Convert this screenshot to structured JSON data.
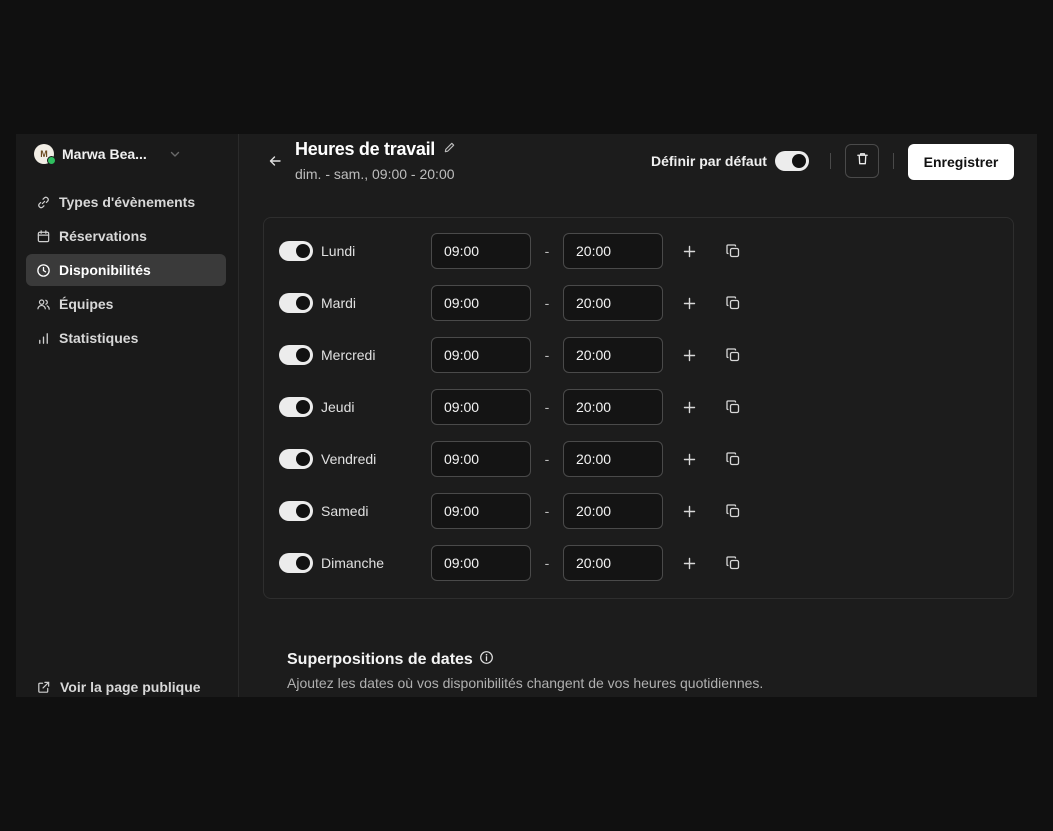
{
  "user": {
    "name": "Marwa Bea...",
    "avatar_initial": "M"
  },
  "nav": {
    "items": [
      {
        "label": "Types d'évènements",
        "icon": "link-icon",
        "active": false
      },
      {
        "label": "Réservations",
        "icon": "calendar-icon",
        "active": false
      },
      {
        "label": "Disponibilités",
        "icon": "clock-icon",
        "active": true
      },
      {
        "label": "Équipes",
        "icon": "users-icon",
        "active": false
      },
      {
        "label": "Statistiques",
        "icon": "bar-chart-icon",
        "active": false
      }
    ],
    "public_page": "Voir la page publique"
  },
  "header": {
    "title": "Heures de travail",
    "subtitle": "dim. - sam., 09:00 - 20:00",
    "default_label": "Définir par défaut",
    "default_on": true,
    "save_label": "Enregistrer"
  },
  "schedule": {
    "days": [
      {
        "day": "Lundi",
        "enabled": true,
        "start": "09:00",
        "end": "20:00"
      },
      {
        "day": "Mardi",
        "enabled": true,
        "start": "09:00",
        "end": "20:00"
      },
      {
        "day": "Mercredi",
        "enabled": true,
        "start": "09:00",
        "end": "20:00"
      },
      {
        "day": "Jeudi",
        "enabled": true,
        "start": "09:00",
        "end": "20:00"
      },
      {
        "day": "Vendredi",
        "enabled": true,
        "start": "09:00",
        "end": "20:00"
      },
      {
        "day": "Samedi",
        "enabled": true,
        "start": "09:00",
        "end": "20:00"
      },
      {
        "day": "Dimanche",
        "enabled": true,
        "start": "09:00",
        "end": "20:00"
      }
    ],
    "separator": "-"
  },
  "overrides": {
    "title": "Superpositions de dates",
    "description": "Ajoutez les dates où vos disponibilités changent de vos heures quotidiennes."
  }
}
